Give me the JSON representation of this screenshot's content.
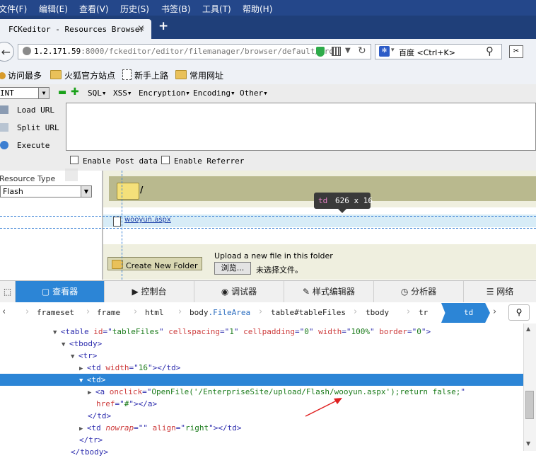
{
  "menubar": {
    "items": [
      "文件(F)",
      "编辑(E)",
      "查看(V)",
      "历史(S)",
      "书签(B)",
      "工具(T)",
      "帮助(H)"
    ]
  },
  "tab": {
    "title": "FCKeditor - Resources Browser",
    "close": "×",
    "new_tab": "+"
  },
  "navbar": {
    "back": "←",
    "url_host": "1.2.171.59",
    "url_path": ":8000/fckeditor/editor/filemanager/browser/default/brow",
    "search_placeholder": "百度 <Ctrl+K>",
    "search_engine_caret": "▾"
  },
  "bookmarks": {
    "items": [
      "访问最多",
      "火狐官方站点",
      "新手上路",
      "常用网址"
    ]
  },
  "hackbar": {
    "select_value": "INT",
    "menus": [
      "SQL▾",
      "XSS▾",
      "Encryption▾",
      "Encoding▾",
      "Other▾"
    ],
    "buttons": [
      "Load URL",
      "Split URL",
      "Execute"
    ],
    "enable_post": "Enable Post data",
    "enable_referrer": "Enable Referrer"
  },
  "filebrowser": {
    "resource_type_label": "Resource Type",
    "resource_type_value": "Flash",
    "current_path": "/",
    "file_name": "wooyun.aspx",
    "create_folder_label": "Create New Folder",
    "upload_label": "Upload a new file in this folder",
    "browse_label": "浏览...",
    "no_file_label": "未选择文件。"
  },
  "inspector_tooltip": {
    "tag": "td",
    "size": "626 x 16"
  },
  "devtools": {
    "tabs": [
      "查看器",
      "控制台",
      "调试器",
      "样式编辑器",
      "分析器",
      "网络"
    ],
    "breadcrumbs": [
      {
        "tag": "frameset",
        "cls": ""
      },
      {
        "tag": "frame",
        "cls": ""
      },
      {
        "tag": "html",
        "cls": ""
      },
      {
        "tag": "body",
        "cls": ".FileArea"
      },
      {
        "tag": "table",
        "cls": "#tableFiles"
      },
      {
        "tag": "tbody",
        "cls": ""
      },
      {
        "tag": "tr",
        "cls": ""
      }
    ],
    "active_crumb": "td",
    "markup": {
      "l1": [
        "<table ",
        "id",
        "=\"",
        "tableFiles",
        "\" ",
        "cellspacing",
        "=\"",
        "1",
        "\" ",
        "cellpadding",
        "=\"",
        "0",
        "\" ",
        "width",
        "=\"",
        "100%",
        "\" ",
        "border",
        "=\"",
        "0",
        "\">"
      ],
      "l2": "<tbody>",
      "l3": "<tr>",
      "l4_open": "<td ",
      "l4_attr": "width",
      "l4_val": "16",
      "l4_close": "></td>",
      "l5": "<td>",
      "l6_open": "<a ",
      "l6_attr": "onclick",
      "l6_val": "OpenFile('/EnterpriseSite/upload/Flash/wooyun.aspx');return false;",
      "l7_attr": "href",
      "l7_val": "#",
      "l7_close": "></a>",
      "l8": "</td>",
      "l9_open": "<td ",
      "l9_attr1": "nowrap",
      "l9_val1": "",
      "l9_attr2": "align",
      "l9_val2": "right",
      "l9_close": "></td>",
      "l10": "</tr>",
      "l11": "</tbody>"
    }
  },
  "colors": {
    "accent": "#2c85d6",
    "menubar": "#24478a",
    "annotation_arrow": "#e02020"
  }
}
